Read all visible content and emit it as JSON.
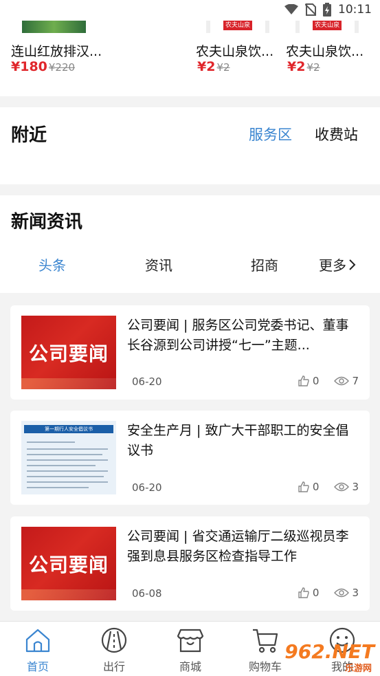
{
  "status_bar": {
    "time": "10:11"
  },
  "products": [
    {
      "name": "连山红放排汉...",
      "price": "¥180",
      "old_price": "¥220"
    },
    {
      "name": "农夫山泉饮...",
      "price": "¥2",
      "old_price": "¥2"
    },
    {
      "name": "农夫山泉饮...",
      "price": "¥2",
      "old_price": "¥2"
    }
  ],
  "product_labels": {
    "water_brand": "农夫山泉"
  },
  "nearby": {
    "title": "附近",
    "tabs": [
      "服务区",
      "收费站"
    ]
  },
  "news": {
    "title": "新闻资讯",
    "tabs": [
      "头条",
      "资讯",
      "招商",
      "更多"
    ]
  },
  "articles": [
    {
      "thumb_text": "公司要闻",
      "title": "公司要闻 | 服务区公司党委书记、董事长谷源到公司讲授“七一”主题...",
      "date": "06-20",
      "likes": "0",
      "views": "7"
    },
    {
      "thumb_text": "第一期行人安全倡议书",
      "title": "安全生产月 | 致广大干部职工的安全倡议书",
      "date": "06-20",
      "likes": "0",
      "views": "3"
    },
    {
      "thumb_text": "公司要闻",
      "title": "公司要闻 | 省交通运输厅二级巡视员李强到息县服务区检查指导工作",
      "date": "06-08",
      "likes": "0",
      "views": "3"
    }
  ],
  "bottom_nav": [
    "首页",
    "出行",
    "商城",
    "购物车",
    "我的"
  ],
  "watermark": {
    "text": "962.NET",
    "sub": "乐游网"
  },
  "colors": {
    "accent": "#3a85d0",
    "price": "#e0262b",
    "watermark": "#f47a20"
  }
}
